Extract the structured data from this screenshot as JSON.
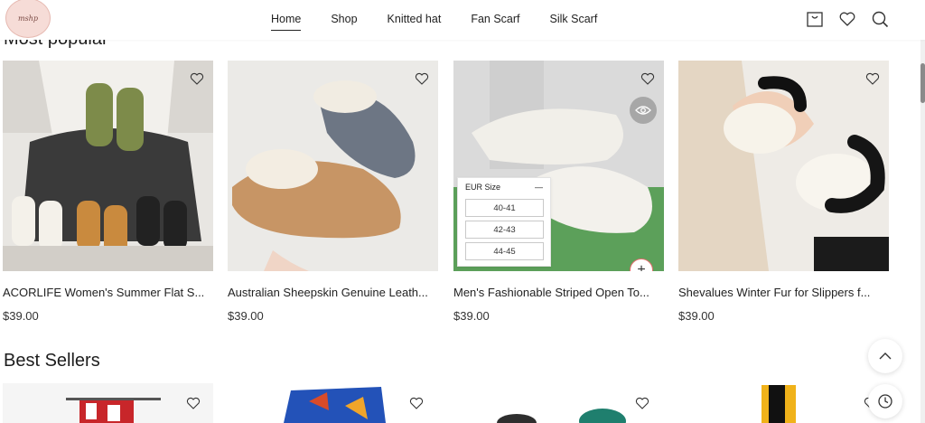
{
  "logo": {
    "text": "mshp"
  },
  "nav": {
    "items": [
      "Home",
      "Shop",
      "Knitted hat",
      "Fan Scarf",
      "Silk Scarf"
    ],
    "active": "Home"
  },
  "header_icons": [
    "shopping-bag-icon",
    "heart-icon",
    "search-icon"
  ],
  "sections": {
    "popular_title": "Most popular",
    "best_sellers_title": "Best Sellers"
  },
  "products": [
    {
      "name": "ACORLIFE Women's Summer Flat S...",
      "price": "$39.00"
    },
    {
      "name": "Australian Sheepskin Genuine Leath...",
      "price": "$39.00"
    },
    {
      "name": "Men's Fashionable Striped Open To...",
      "price": "$39.00"
    },
    {
      "name": "Shevalues Winter Fur for Slippers f...",
      "price": "$39.00"
    }
  ],
  "size_panel": {
    "title": "EUR Size",
    "options": [
      "40-41",
      "42-43",
      "44-45"
    ]
  },
  "accent_color": "#e46d6d"
}
